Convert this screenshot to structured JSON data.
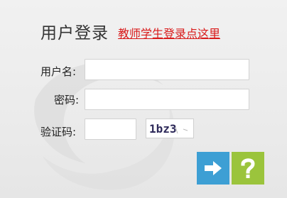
{
  "login": {
    "title": "用户登录",
    "teacher_link": "教师学生登录点这里",
    "username_label": "用户名:",
    "username_value": "",
    "password_label": "密码:",
    "password_value": "",
    "captcha_label": "验证码:",
    "captcha_value": "",
    "captcha_text": "1bz3"
  },
  "icons": {
    "submit": "arrow-right-icon",
    "help": "question-mark-icon"
  },
  "colors": {
    "link": "#d91a1a",
    "submit_button": "#3d9fd4",
    "help_button": "#9bc43c",
    "captcha_text": "#2e2a5a"
  }
}
